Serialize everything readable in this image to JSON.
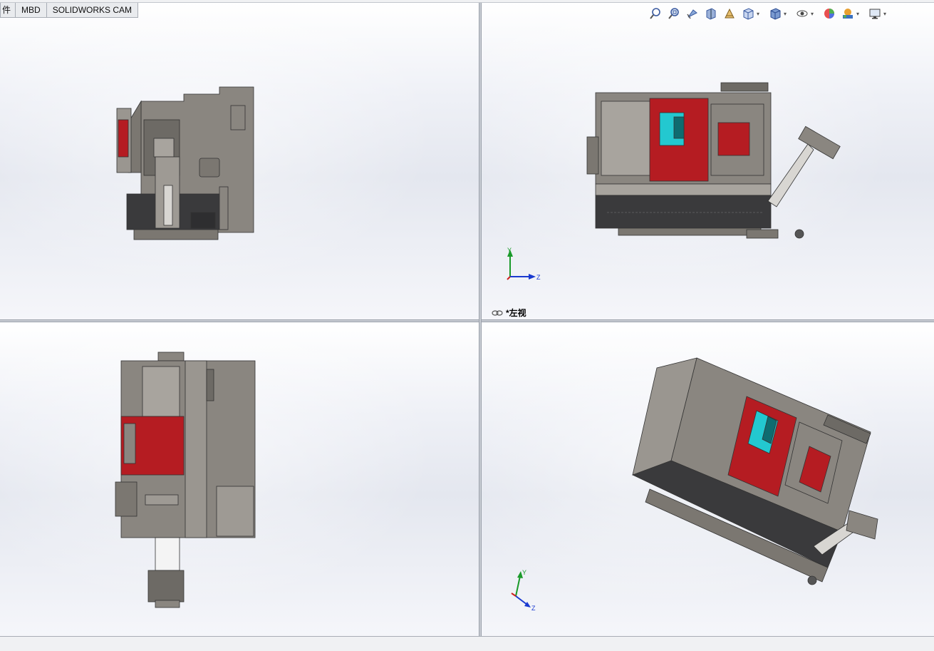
{
  "tabs": [
    {
      "label": "件"
    },
    {
      "label": "MBD"
    },
    {
      "label": "SOLIDWORKS CAM"
    }
  ],
  "hud_toolbar": [
    {
      "icon": "zoom-to-fit-icon"
    },
    {
      "icon": "zoom-to-area-icon"
    },
    {
      "icon": "previous-view-icon"
    },
    {
      "icon": "section-view-icon"
    },
    {
      "icon": "dynamic-annotation-icon"
    },
    {
      "icon": "view-orientation-icon",
      "dropdown": true
    },
    {
      "icon": "display-style-icon",
      "dropdown": true
    },
    {
      "icon": "hide-show-items-icon",
      "dropdown": true
    },
    {
      "icon": "edit-appearance-icon"
    },
    {
      "icon": "apply-scene-icon",
      "dropdown": true
    },
    {
      "icon": "view-settings-icon",
      "dropdown": true
    }
  ],
  "viewports": {
    "top_right": {
      "view_label": "*左视"
    }
  },
  "triad": {
    "y": "Y",
    "z": "Z",
    "x": "X"
  },
  "colors": {
    "machine_body": "#8a8680",
    "machine_door": "#b51c22",
    "machine_glass": "#23c8d0",
    "machine_base": "#3a3a3c",
    "axis_y": "#1a9a2a",
    "axis_z": "#1a3ad0",
    "axis_x": "#d02020"
  }
}
